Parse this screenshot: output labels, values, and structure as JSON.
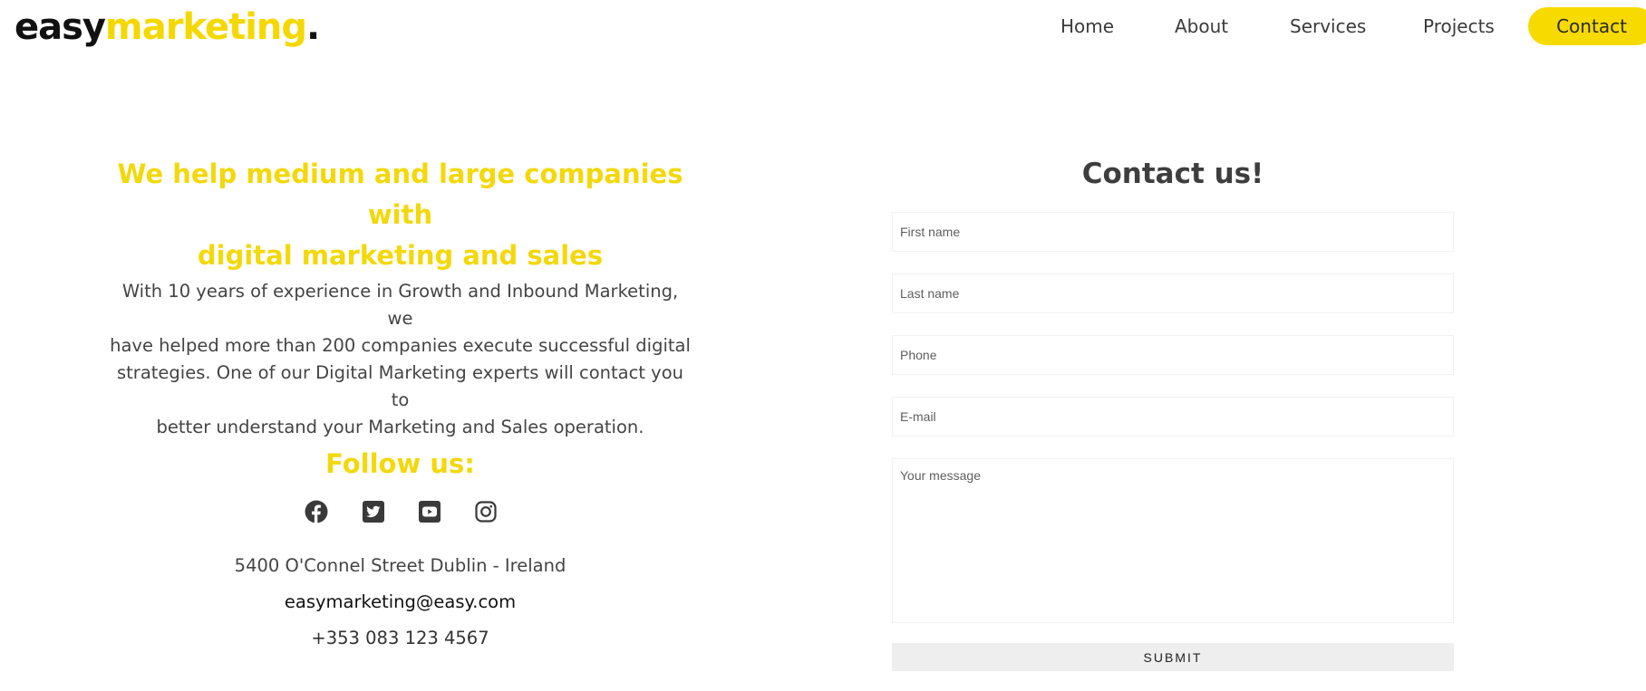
{
  "brand": {
    "part1": "easy",
    "part2": "marketing",
    "dot": ".",
    "accent_color": "#f5d800"
  },
  "nav": {
    "home": "Home",
    "about": "About",
    "services": "Services",
    "projects": "Projects",
    "contact": "Contact"
  },
  "hero": {
    "headline_line1": "We help medium and large companies with",
    "headline_line2": "digital marketing and sales",
    "intro_lines": [
      "With 10 years of experience in Growth and Inbound Marketing, we",
      "have helped more than 200 companies execute successful digital",
      "strategies. One of our Digital Marketing experts will contact you to",
      "better understand your Marketing and Sales operation."
    ]
  },
  "follow": {
    "title": "Follow us:",
    "icons": [
      "facebook-icon",
      "twitter-icon",
      "youtube-icon",
      "instagram-icon"
    ]
  },
  "contact_info": {
    "address": "5400 O'Connel Street Dublin - Ireland",
    "email": "easymarketing@easy.com",
    "phone": "+353 083 123 4567"
  },
  "form": {
    "title": "Contact us!",
    "first_name_placeholder": "First name",
    "last_name_placeholder": "Last name",
    "phone_placeholder": "Phone",
    "email_placeholder": "E-mail",
    "message_placeholder": "Your message",
    "submit_label": "SUBMIT"
  }
}
